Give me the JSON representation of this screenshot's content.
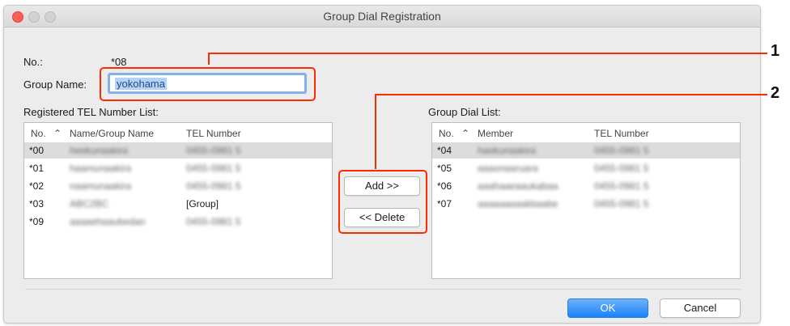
{
  "window": {
    "title": "Group Dial Registration"
  },
  "header": {
    "no_label": "No.:",
    "no_value": "*08",
    "group_name_label": "Group Name:",
    "group_name_value": "yokohama"
  },
  "registered_list": {
    "title": "Registered TEL Number List:",
    "columns": [
      "No.",
      "Name/Group Name",
      "TEL Number"
    ],
    "rows": [
      {
        "no": "*00",
        "name": "heekunaakira",
        "tel": "0455-0981 5"
      },
      {
        "no": "*01",
        "name": "haamunaakira",
        "tel": "0455-0981 5"
      },
      {
        "no": "*02",
        "name": "naamunaakira",
        "tel": "0455-0981 5"
      },
      {
        "no": "*03",
        "name": "ABC2BC",
        "tel": "[Group]"
      },
      {
        "no": "*09",
        "name": "aaaaehaaubedan",
        "tel": "0455-0981 5"
      }
    ]
  },
  "group_list": {
    "title": "Group Dial List:",
    "columns": [
      "No.",
      "Member",
      "TEL Number"
    ],
    "rows": [
      {
        "no": "*04",
        "name": "haekunaakira",
        "tel": "0455-0981 5"
      },
      {
        "no": "*05",
        "name": "aaaonaaruara",
        "tel": "0455-0981 5"
      },
      {
        "no": "*06",
        "name": "aaahaaeaaukabaa",
        "tel": "0455-0981 5"
      },
      {
        "no": "*07",
        "name": "aaaaaaaaakbaabe",
        "tel": "0455-0981 5"
      }
    ]
  },
  "buttons": {
    "add": "Add >>",
    "delete": "<< Delete",
    "ok": "OK",
    "cancel": "Cancel"
  },
  "callouts": {
    "one": "1",
    "two": "2"
  },
  "colors": {
    "callout": "#ff2a00",
    "ok_button": "#1a82fb",
    "selection": "#b4d3f7"
  }
}
